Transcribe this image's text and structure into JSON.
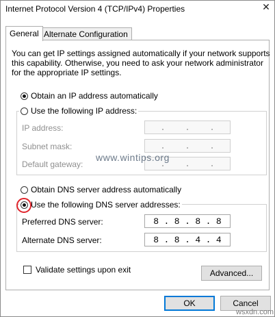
{
  "window": {
    "title": "Internet Protocol Version 4 (TCP/IPv4) Properties",
    "close_glyph": "✕"
  },
  "tabs": [
    {
      "label": "General",
      "active": true
    },
    {
      "label": "Alternate Configuration",
      "active": false
    }
  ],
  "description": [
    "You can get IP settings assigned automatically if your network supports",
    "this capability. Otherwise, you need to ask your network administrator",
    "for the appropriate IP settings."
  ],
  "ip_section": {
    "auto_label": "Obtain an IP address automatically",
    "auto_checked": true,
    "manual_label": "Use the following IP address:",
    "manual_checked": false,
    "fields": [
      {
        "label": "IP address:",
        "value": [
          ".",
          ".",
          "."
        ]
      },
      {
        "label": "Subnet mask:",
        "value": [
          ".",
          ".",
          "."
        ]
      },
      {
        "label": "Default gateway:",
        "value": [
          ".",
          ".",
          "."
        ]
      }
    ]
  },
  "dns_section": {
    "auto_label": "Obtain DNS server address automatically",
    "auto_checked": false,
    "manual_label": "Use the following DNS server addresses:",
    "manual_checked": true,
    "preferred": {
      "label": "Preferred DNS server:",
      "octets": [
        "8",
        "8",
        "8",
        "8"
      ]
    },
    "alternate": {
      "label": "Alternate DNS server:",
      "octets": [
        "8",
        "8",
        "4",
        "4"
      ]
    }
  },
  "validate": {
    "label": "Validate settings upon exit",
    "checked": false
  },
  "buttons": {
    "advanced": "Advanced...",
    "ok": "OK",
    "cancel": "Cancel"
  },
  "watermark": "www.wintips.org",
  "corner_watermark": "wsxdn.com",
  "colors": {
    "highlight_ring": "#e0242b",
    "default_button_border": "#0078d7"
  }
}
